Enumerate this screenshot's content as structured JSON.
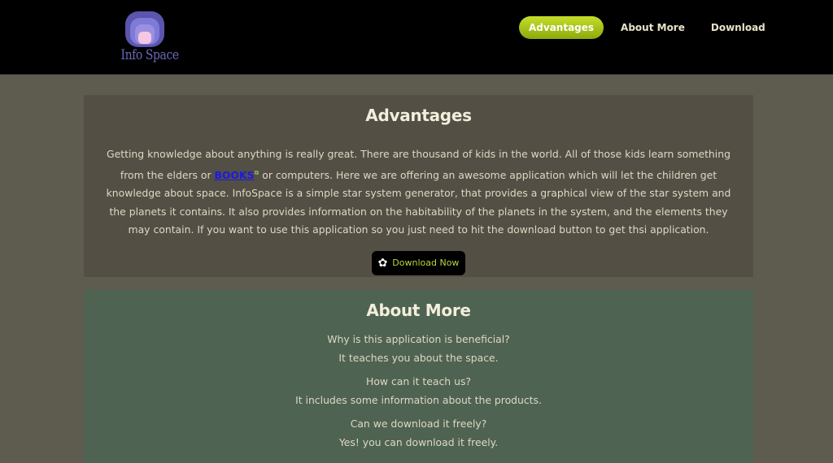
{
  "header": {
    "logo_text": "Info Space",
    "nav": [
      {
        "label": "Advantages",
        "active": true
      },
      {
        "label": "About More",
        "active": false
      },
      {
        "label": "Download",
        "active": false
      }
    ]
  },
  "advantages": {
    "title": "Advantages",
    "text_before_link": "Getting knowledge about anything is really great. There are thousand of kids in the world. All of those kids learn something from the elders or ",
    "link_text": "BOOKS",
    "text_after_link": " or computers. Here we are offering an awesome application which will let the children get knowledge about space. InfoSpace is a simple star system generator, that provides a graphical view of the star system and the planets it contains. It also provides information on the habitability of the planets in the system, and the elements they may contain. If you want to use this application so you just need to hit the download button to get thsi application.",
    "download_label": "Download Now"
  },
  "about": {
    "title": "About More",
    "qa": [
      {
        "q": "Why is this application is beneficial?",
        "a": "It teaches you about the space."
      },
      {
        "q": "How can it teach us?",
        "a": "It includes some information about the products."
      },
      {
        "q": "Can we download it freely?",
        "a": "Yes! you can download it freely."
      }
    ]
  },
  "colors": {
    "accent": "#b6d63a",
    "page_bg": "#5e5b4f",
    "advantages_bg": "#544f44",
    "about_bg": "#4f6352"
  },
  "icons": {
    "external_link": "external-link-icon",
    "download": "gear-icon"
  }
}
